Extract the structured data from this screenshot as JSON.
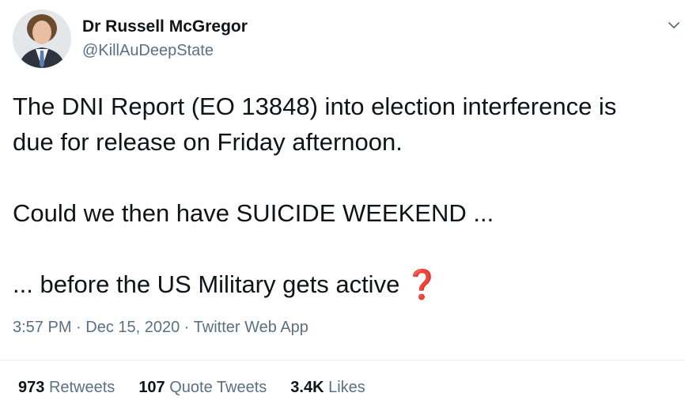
{
  "author": {
    "display_name": "Dr Russell McGregor",
    "handle": "@KillAuDeepState"
  },
  "tweet": {
    "line1": "The DNI Report (EO 13848) into election interference is",
    "line2": "due for release on Friday afternoon.",
    "line3": "Could we then have SUICIDE WEEKEND ...",
    "line4": "... before the US Military gets active",
    "emoji": "❓"
  },
  "meta": {
    "time": "3:57 PM",
    "sep1": " · ",
    "date": "Dec 15, 2020",
    "sep2": " · ",
    "source": "Twitter Web App"
  },
  "stats": {
    "retweets_count": "973",
    "retweets_label": "Retweets",
    "quotes_count": "107",
    "quotes_label": "Quote Tweets",
    "likes_count": "3.4K",
    "likes_label": "Likes"
  },
  "colors": {
    "text": "#0f1419",
    "secondary": "#5b7083",
    "emoji_red": "#d4182d",
    "divider": "#e6ecf0"
  },
  "icons": {
    "caret": "chevron-down-icon"
  }
}
